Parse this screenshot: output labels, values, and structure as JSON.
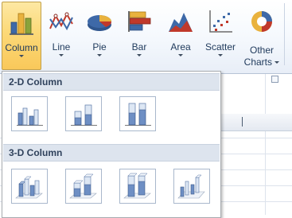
{
  "ribbon": {
    "buttons": [
      {
        "label": "Column",
        "icon": "column-chart-icon",
        "selected": true
      },
      {
        "label": "Line",
        "icon": "line-chart-icon"
      },
      {
        "label": "Pie",
        "icon": "pie-chart-icon"
      },
      {
        "label": "Bar",
        "icon": "bar-chart-icon"
      },
      {
        "label": "Area",
        "icon": "area-chart-icon"
      },
      {
        "label": "Scatter",
        "icon": "scatter-chart-icon"
      },
      {
        "label": "Other",
        "label2": "Charts",
        "icon": "other-charts-icon"
      }
    ]
  },
  "gallery": {
    "sections": [
      {
        "title": "2-D Column",
        "items": [
          "clustered-column-icon",
          "stacked-column-icon",
          "100-percent-stacked-column-icon"
        ]
      },
      {
        "title": "3-D Column",
        "items": [
          "3d-clustered-column-icon",
          "3d-stacked-column-icon",
          "3d-100-percent-stacked-column-icon",
          "3d-column-icon"
        ]
      }
    ]
  },
  "colors": {
    "selected_button": "#fcd978",
    "section_header": "#dde4ee",
    "bar_blue": "#4f6fa6"
  }
}
